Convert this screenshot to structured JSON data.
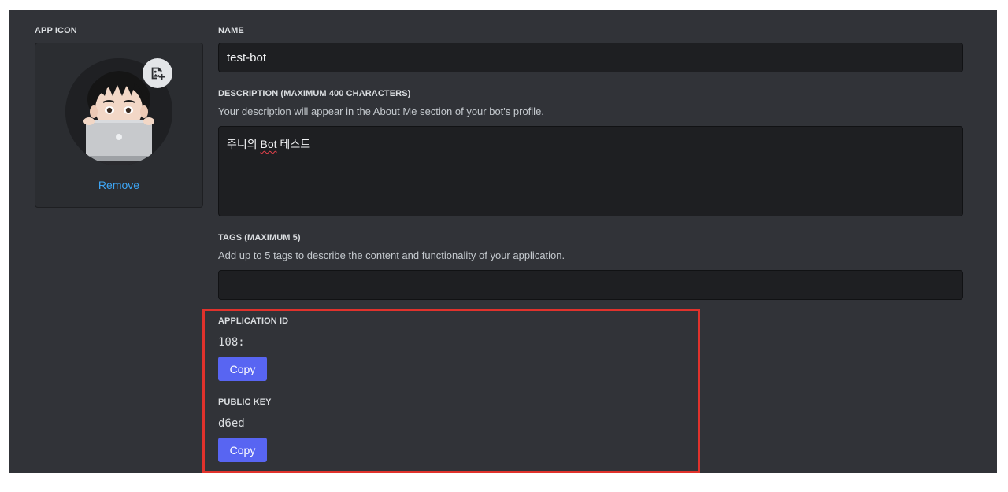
{
  "app_icon": {
    "label": "APP ICON",
    "remove_label": "Remove"
  },
  "name": {
    "label": "NAME",
    "value": "test-bot"
  },
  "description": {
    "label": "DESCRIPTION (MAXIMUM 400 CHARACTERS)",
    "help": "Your description will appear in the About Me section of your bot's profile.",
    "value_prefix": "주니의 ",
    "value_underlined": "Bot",
    "value_suffix": " 테스트"
  },
  "tags": {
    "label": "TAGS (MAXIMUM 5)",
    "help": "Add up to 5 tags to describe the content and functionality of your application.",
    "value": ""
  },
  "application_id": {
    "label": "APPLICATION ID",
    "value": "108:",
    "copy_label": "Copy"
  },
  "public_key": {
    "label": "PUBLIC KEY",
    "value": "d6ed",
    "copy_label": "Copy"
  },
  "colors": {
    "panel_bg": "#313338",
    "input_bg": "#1e1f22",
    "accent": "#5865f2",
    "link": "#3ea6f5",
    "highlight": "#e0322c"
  },
  "icons": {
    "upload": "image-plus-icon",
    "avatar": "memoji-avatar-with-laptop"
  }
}
